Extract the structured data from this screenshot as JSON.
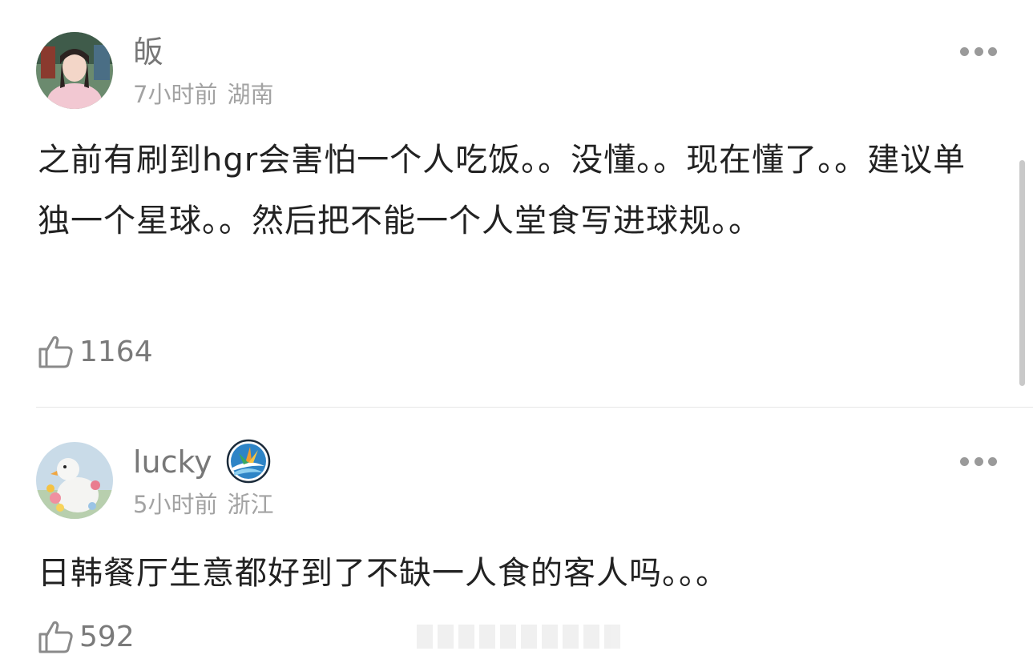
{
  "comments": [
    {
      "username": "皈",
      "time": "7小时前",
      "location": "湖南",
      "text": "之前有刷到hgr会害怕一个人吃饭。。没懂。。现在懂了。。建议单独一个星球。。然后把不能一个人堂食写进球规。。",
      "likes": "1164",
      "avatar_icon": "girl-portrait-avatar"
    },
    {
      "username": "lucky",
      "time": "5小时前",
      "location": "浙江",
      "text": "日韩餐厅生意都好到了不缺一人食的客人吗。。。",
      "likes": "592",
      "avatar_icon": "duck-with-flowers-avatar",
      "badge_icon": "bird-of-paradise-badge-icon"
    }
  ],
  "colors": {
    "username": "#777777",
    "meta": "#a3a3a3",
    "text": "#222222",
    "icon": "#8a8a8a"
  }
}
